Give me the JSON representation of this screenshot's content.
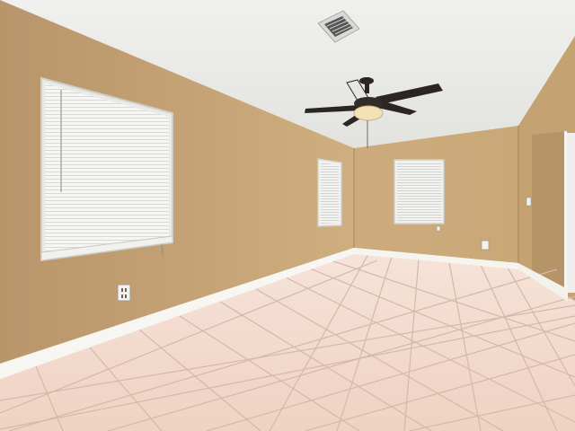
{
  "scene": {
    "kind": "photograph",
    "subject": "empty-room",
    "elements": [
      "ceiling",
      "left-wall",
      "back-wall",
      "right-wall",
      "tile-floor",
      "baseboard",
      "ceiling-fan",
      "air-vent",
      "window-blinds",
      "back-window-left",
      "back-window-right",
      "doorway",
      "wall-outlet"
    ],
    "colors": {
      "ceiling": "#ebebe8",
      "wall": "#c8a676",
      "wall_shadow": "#a98a5e",
      "floor_tile": "#f1d6c7",
      "grout": "#cfb3a3",
      "baseboard": "#f8f6f2",
      "blinds": "#f4f4f2",
      "fan_blade": "#2b2624",
      "fan_light": "#f3e2b8"
    }
  }
}
